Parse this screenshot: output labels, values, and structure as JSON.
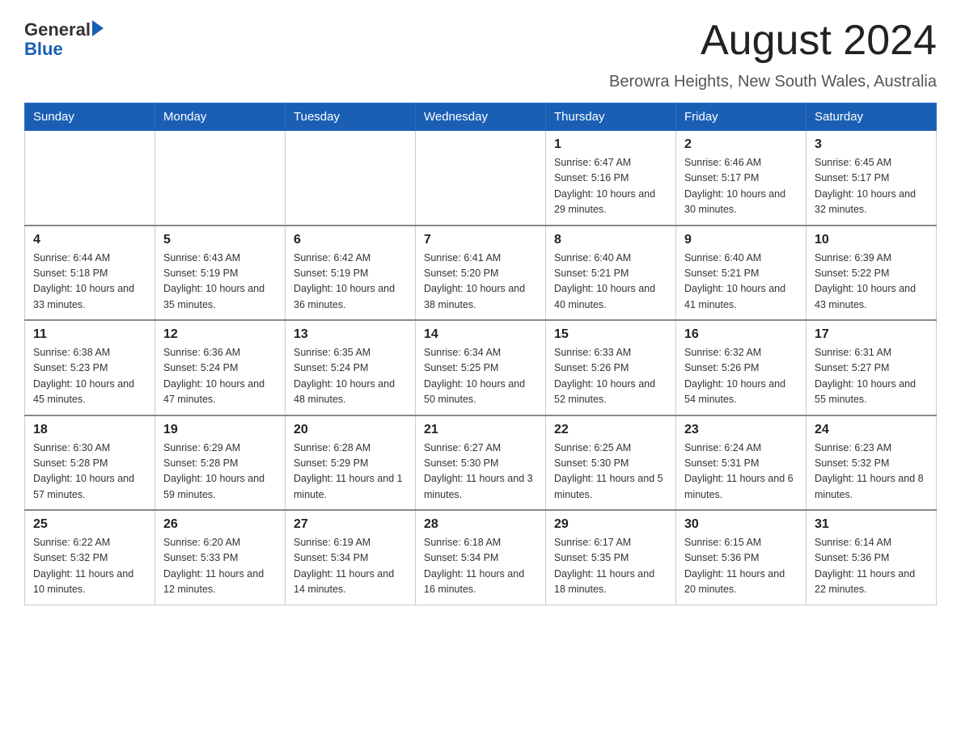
{
  "logo": {
    "text_general": "General",
    "text_blue": "Blue"
  },
  "header": {
    "month_title": "August 2024",
    "location": "Berowra Heights, New South Wales, Australia"
  },
  "days_of_week": [
    "Sunday",
    "Monday",
    "Tuesday",
    "Wednesday",
    "Thursday",
    "Friday",
    "Saturday"
  ],
  "weeks": [
    [
      {
        "day": "",
        "info": ""
      },
      {
        "day": "",
        "info": ""
      },
      {
        "day": "",
        "info": ""
      },
      {
        "day": "",
        "info": ""
      },
      {
        "day": "1",
        "info": "Sunrise: 6:47 AM\nSunset: 5:16 PM\nDaylight: 10 hours and 29 minutes."
      },
      {
        "day": "2",
        "info": "Sunrise: 6:46 AM\nSunset: 5:17 PM\nDaylight: 10 hours and 30 minutes."
      },
      {
        "day": "3",
        "info": "Sunrise: 6:45 AM\nSunset: 5:17 PM\nDaylight: 10 hours and 32 minutes."
      }
    ],
    [
      {
        "day": "4",
        "info": "Sunrise: 6:44 AM\nSunset: 5:18 PM\nDaylight: 10 hours and 33 minutes."
      },
      {
        "day": "5",
        "info": "Sunrise: 6:43 AM\nSunset: 5:19 PM\nDaylight: 10 hours and 35 minutes."
      },
      {
        "day": "6",
        "info": "Sunrise: 6:42 AM\nSunset: 5:19 PM\nDaylight: 10 hours and 36 minutes."
      },
      {
        "day": "7",
        "info": "Sunrise: 6:41 AM\nSunset: 5:20 PM\nDaylight: 10 hours and 38 minutes."
      },
      {
        "day": "8",
        "info": "Sunrise: 6:40 AM\nSunset: 5:21 PM\nDaylight: 10 hours and 40 minutes."
      },
      {
        "day": "9",
        "info": "Sunrise: 6:40 AM\nSunset: 5:21 PM\nDaylight: 10 hours and 41 minutes."
      },
      {
        "day": "10",
        "info": "Sunrise: 6:39 AM\nSunset: 5:22 PM\nDaylight: 10 hours and 43 minutes."
      }
    ],
    [
      {
        "day": "11",
        "info": "Sunrise: 6:38 AM\nSunset: 5:23 PM\nDaylight: 10 hours and 45 minutes."
      },
      {
        "day": "12",
        "info": "Sunrise: 6:36 AM\nSunset: 5:24 PM\nDaylight: 10 hours and 47 minutes."
      },
      {
        "day": "13",
        "info": "Sunrise: 6:35 AM\nSunset: 5:24 PM\nDaylight: 10 hours and 48 minutes."
      },
      {
        "day": "14",
        "info": "Sunrise: 6:34 AM\nSunset: 5:25 PM\nDaylight: 10 hours and 50 minutes."
      },
      {
        "day": "15",
        "info": "Sunrise: 6:33 AM\nSunset: 5:26 PM\nDaylight: 10 hours and 52 minutes."
      },
      {
        "day": "16",
        "info": "Sunrise: 6:32 AM\nSunset: 5:26 PM\nDaylight: 10 hours and 54 minutes."
      },
      {
        "day": "17",
        "info": "Sunrise: 6:31 AM\nSunset: 5:27 PM\nDaylight: 10 hours and 55 minutes."
      }
    ],
    [
      {
        "day": "18",
        "info": "Sunrise: 6:30 AM\nSunset: 5:28 PM\nDaylight: 10 hours and 57 minutes."
      },
      {
        "day": "19",
        "info": "Sunrise: 6:29 AM\nSunset: 5:28 PM\nDaylight: 10 hours and 59 minutes."
      },
      {
        "day": "20",
        "info": "Sunrise: 6:28 AM\nSunset: 5:29 PM\nDaylight: 11 hours and 1 minute."
      },
      {
        "day": "21",
        "info": "Sunrise: 6:27 AM\nSunset: 5:30 PM\nDaylight: 11 hours and 3 minutes."
      },
      {
        "day": "22",
        "info": "Sunrise: 6:25 AM\nSunset: 5:30 PM\nDaylight: 11 hours and 5 minutes."
      },
      {
        "day": "23",
        "info": "Sunrise: 6:24 AM\nSunset: 5:31 PM\nDaylight: 11 hours and 6 minutes."
      },
      {
        "day": "24",
        "info": "Sunrise: 6:23 AM\nSunset: 5:32 PM\nDaylight: 11 hours and 8 minutes."
      }
    ],
    [
      {
        "day": "25",
        "info": "Sunrise: 6:22 AM\nSunset: 5:32 PM\nDaylight: 11 hours and 10 minutes."
      },
      {
        "day": "26",
        "info": "Sunrise: 6:20 AM\nSunset: 5:33 PM\nDaylight: 11 hours and 12 minutes."
      },
      {
        "day": "27",
        "info": "Sunrise: 6:19 AM\nSunset: 5:34 PM\nDaylight: 11 hours and 14 minutes."
      },
      {
        "day": "28",
        "info": "Sunrise: 6:18 AM\nSunset: 5:34 PM\nDaylight: 11 hours and 16 minutes."
      },
      {
        "day": "29",
        "info": "Sunrise: 6:17 AM\nSunset: 5:35 PM\nDaylight: 11 hours and 18 minutes."
      },
      {
        "day": "30",
        "info": "Sunrise: 6:15 AM\nSunset: 5:36 PM\nDaylight: 11 hours and 20 minutes."
      },
      {
        "day": "31",
        "info": "Sunrise: 6:14 AM\nSunset: 5:36 PM\nDaylight: 11 hours and 22 minutes."
      }
    ]
  ]
}
